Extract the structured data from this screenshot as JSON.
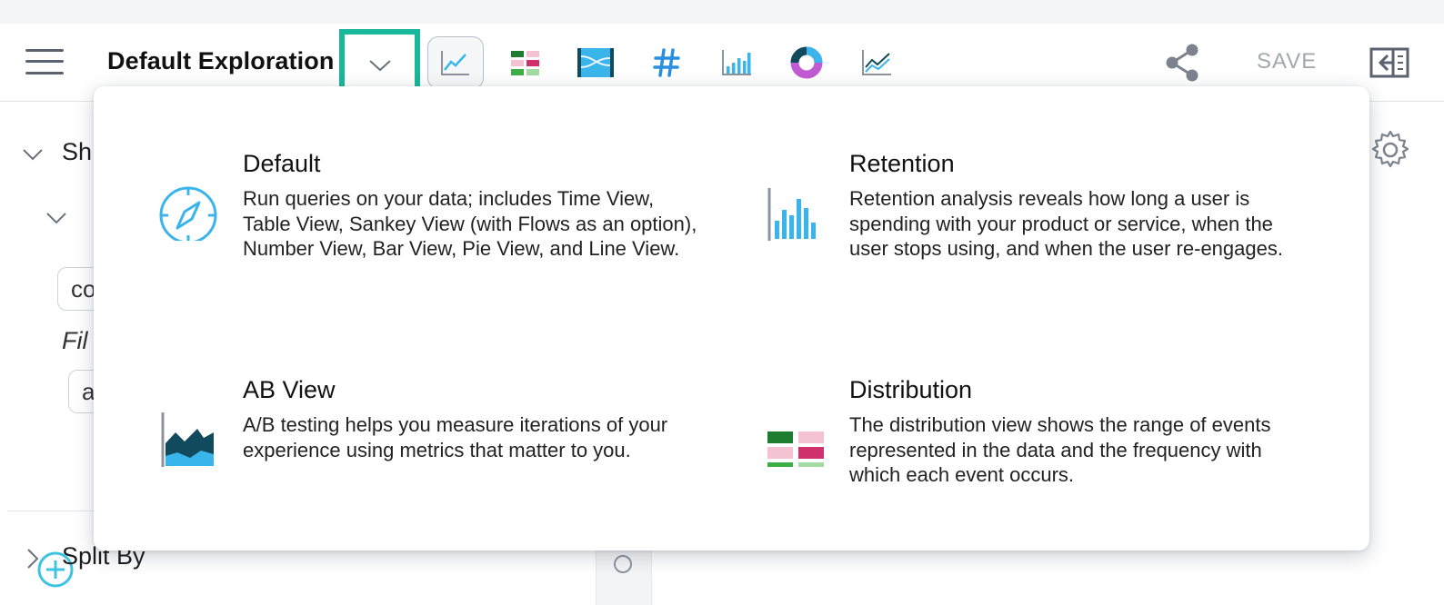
{
  "toolbar": {
    "title": "Default Exploration",
    "save_label": "SAVE",
    "views": [
      "time-view",
      "table-view",
      "sankey-view",
      "number-view",
      "bar-view",
      "pie-view",
      "line-view"
    ]
  },
  "sidebar": {
    "section1_label": "Sh",
    "field1_value": "co",
    "filter_label": "Fil",
    "field2_value": "a",
    "split_label": "Split By"
  },
  "menu": {
    "options": [
      {
        "title": "Default",
        "description": "Run queries on your data; includes Time View, Table View, Sankey View (with Flows as an option), Number View, Bar View, Pie View, and Line View.",
        "icon": "compass-icon"
      },
      {
        "title": "Retention",
        "description": "Retention analysis reveals how long a user is spending with your product or service, when the user stops using, and when the user re-engages.",
        "icon": "bar-chart-icon"
      },
      {
        "title": "AB View",
        "description": "A/B testing helps you measure iterations of your experience using metrics that matter to you.",
        "icon": "area-chart-icon"
      },
      {
        "title": "Distribution",
        "description": "The distribution view shows the range of events represented in the data and the frequency with which each event occurs.",
        "icon": "grid-icon"
      }
    ]
  },
  "colors": {
    "accent_teal": "#19b89a",
    "icon_blue": "#3ab5ec",
    "dark_teal": "#114a5c"
  }
}
